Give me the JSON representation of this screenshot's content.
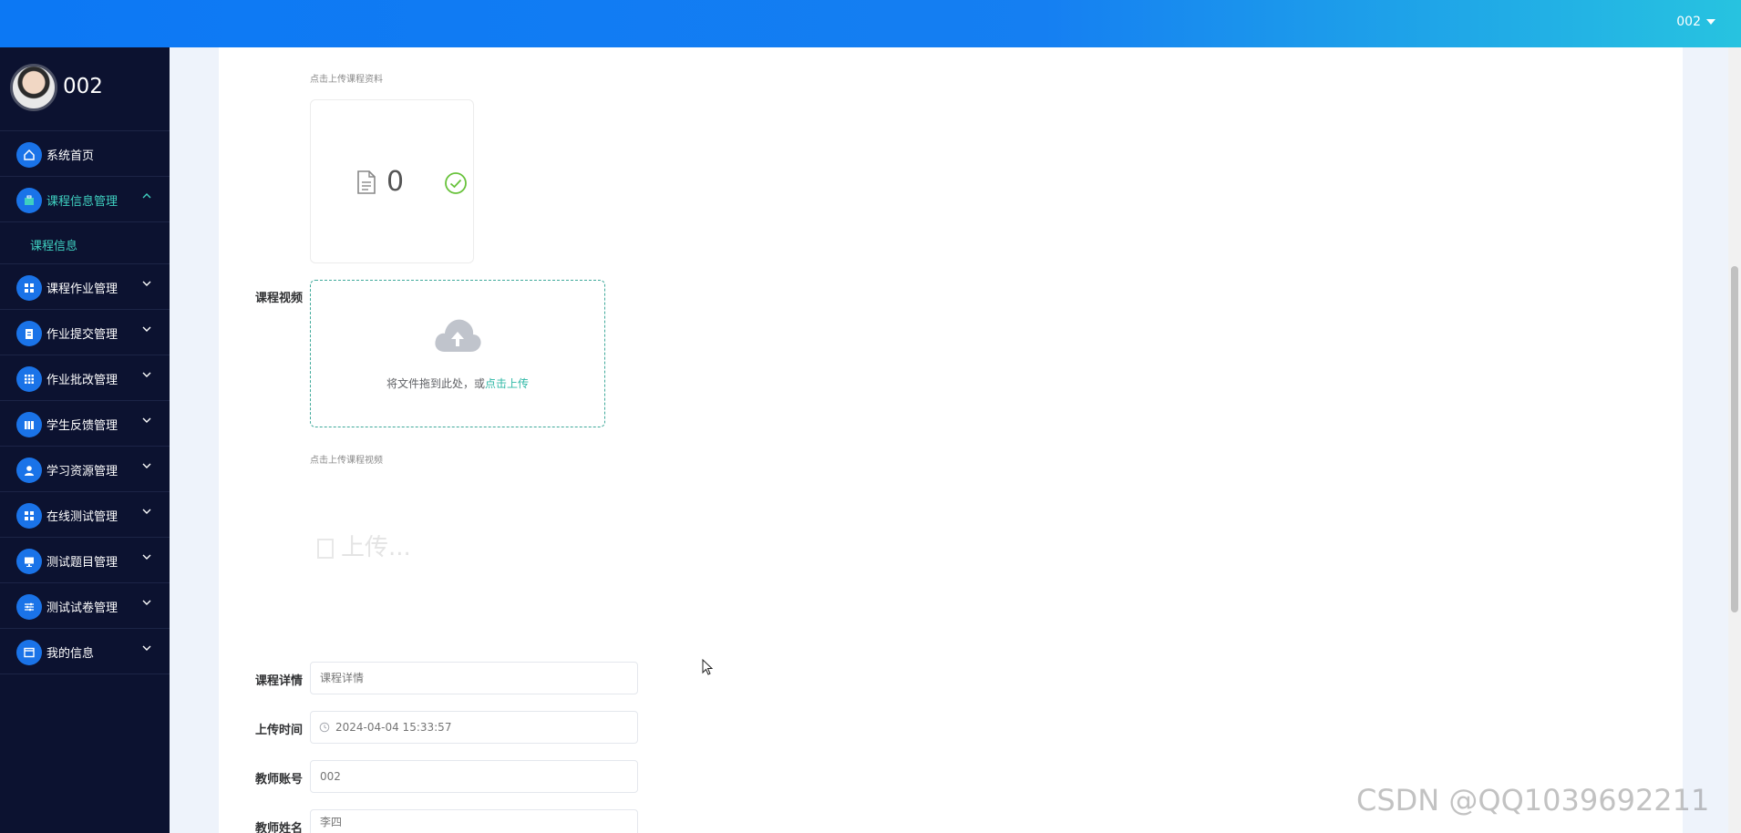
{
  "header": {
    "username": "002"
  },
  "sidebar": {
    "profile_name": "002",
    "items": [
      {
        "label": "系统首页",
        "icon": "home-icon",
        "expanded": false
      },
      {
        "label": "课程信息管理",
        "icon": "briefcase-icon",
        "expanded": true,
        "active": true,
        "children": [
          {
            "label": "课程信息"
          }
        ]
      },
      {
        "label": "课程作业管理",
        "icon": "grid-icon"
      },
      {
        "label": "作业提交管理",
        "icon": "clipboard-icon"
      },
      {
        "label": "作业批改管理",
        "icon": "apps-icon"
      },
      {
        "label": "学生反馈管理",
        "icon": "books-icon"
      },
      {
        "label": "学习资源管理",
        "icon": "user-icon"
      },
      {
        "label": "在线测试管理",
        "icon": "grid-icon"
      },
      {
        "label": "测试题目管理",
        "icon": "monitor-icon"
      },
      {
        "label": "测试试卷管理",
        "icon": "sliders-icon"
      },
      {
        "label": "我的信息",
        "icon": "window-icon"
      }
    ]
  },
  "form": {
    "material_hint": "点击上传课程资料",
    "material_count": "0",
    "video_label": "课程视频",
    "upload_text": "将文件拖到此处，或",
    "upload_link": "点击上传",
    "video_hint": "点击上传课程视频",
    "ghost_upload": "上传...",
    "detail_label": "课程详情",
    "detail_placeholder": "课程详情",
    "time_label": "上传时间",
    "time_value": "2024-04-04 15:33:57",
    "teacher_account_label": "教师账号",
    "teacher_account_value": "002",
    "teacher_name_label": "教师姓名",
    "teacher_name_value": "李四"
  },
  "watermark": "CSDN @QQ1039692211",
  "colors": {
    "accent": "#1a73e8",
    "active_text": "#3fd0c0",
    "sidebar_bg": "#0c1230"
  }
}
